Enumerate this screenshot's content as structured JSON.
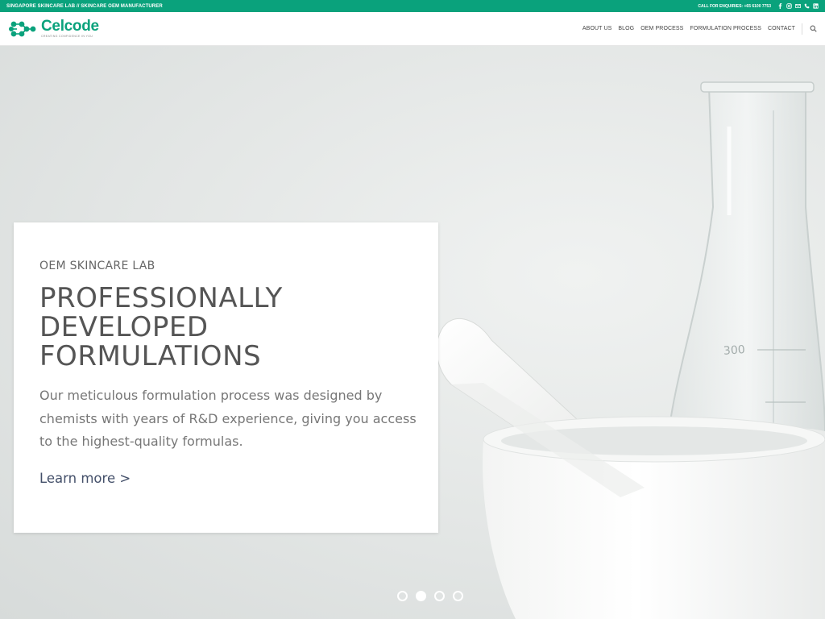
{
  "topbar": {
    "left_text": "SINGAPORE SKINCARE LAB // SKINCARE OEM MANUFACTURER",
    "enquiries_text": "CALL FOR ENQUIRIES: +65 6100 7753",
    "social_icons": [
      "facebook-icon",
      "instagram-icon",
      "email-icon",
      "phone-icon",
      "linkedin-icon"
    ]
  },
  "header": {
    "logo_name": "Celcode",
    "logo_tagline": "CREATING CONFIDENCE IN YOU",
    "nav": [
      {
        "label": "ABOUT US"
      },
      {
        "label": "BLOG"
      },
      {
        "label": "OEM PROCESS"
      },
      {
        "label": "FORMULATION PROCESS"
      },
      {
        "label": "CONTACT"
      }
    ],
    "search_icon": "search-icon"
  },
  "hero": {
    "kicker": "OEM SKINCARE LAB",
    "headline_lines": [
      "PROFESSIONALLY",
      "DEVELOPED",
      "FORMULATIONS"
    ],
    "body": "Our meticulous formulation process was designed by chemists with years of R&D experience, giving you access to the highest-quality formulas.",
    "cta": "Learn more >",
    "beaker_marking": "300",
    "slides_total": 4,
    "active_slide": 2
  },
  "colors": {
    "brand_green": "#0aa27c",
    "text_dark": "#555555",
    "link": "#44506a"
  }
}
